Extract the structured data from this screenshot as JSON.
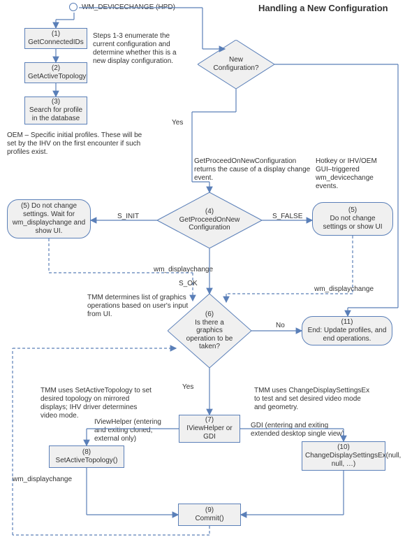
{
  "title": "Handling a New Configuration",
  "start_label": "WM_DEVICECHANGE (HPD)",
  "notes": {
    "steps_enum": "Steps 1-3 enumerate the current configuration and determine whether this is a new display configuration.",
    "oem_profiles": "OEM – Specific initial profiles. These will be set by the IHV on the first encounter if such profiles exist.",
    "getproceed_cause": "GetProceedOnNewConfiguration returns the cause of a display change event.",
    "hotkey": "Hotkey or IHV/OEM GUI–triggered wm_devicechange events.",
    "tmm_list": "TMM determines list of graphics operations based on user's input from UI.",
    "tmm_setactive": "TMM uses SetActiveTopology to set desired topology on mirrored displays; IHV driver determines video mode.",
    "iview_note": "IViewHelper (entering and exiting cloned, external only)",
    "gdi_note": "GDI (entering and exiting extended desktop single view)",
    "tmm_cds": "TMM uses ChangeDisplaySettingsEx to test and set desired video mode and geometry."
  },
  "nodes": {
    "n1": {
      "num": "(1)",
      "label": "GetConnectedIDs"
    },
    "n2": {
      "num": "(2)",
      "label": "GetActiveTopology"
    },
    "n3": {
      "num": "(3)",
      "label": "Search for profile in the database"
    },
    "d_newcfg": {
      "label": "New Configuration?"
    },
    "n4": {
      "num": "(4)",
      "label": "GetProceedOnNew Configuration"
    },
    "n5a": {
      "num": "(5) Do not change settings. Wait for wm_displaychange and show UI."
    },
    "n5b": {
      "num": "(5)",
      "label": "Do not change settings or show UI"
    },
    "d6": {
      "num": "(6)",
      "label": "Is there a graphics operation to be taken?"
    },
    "n7": {
      "num": "(7)",
      "label": "IViewHelper or GDI"
    },
    "n8": {
      "num": "(8)",
      "label": "SetActiveTopology()"
    },
    "n9": {
      "num": "(9)",
      "label": "Commit()"
    },
    "n10": {
      "num": "(10)",
      "label": "ChangeDisplaySettingsEx(null, null, …)"
    },
    "n11": {
      "num": "(11)",
      "label": "End:  Update profiles, and end operations."
    }
  },
  "edges": {
    "yes": "Yes",
    "no": "No",
    "s_init": "S_INIT",
    "s_false": "S_FALSE",
    "s_ok": "S_OK",
    "wm_dc_left": "wm_displaychange",
    "wm_dc_mid": "wm_displaychange",
    "wm_dc_right": "wm_displaychange"
  },
  "chart_data": {
    "type": "flowchart",
    "title": "Handling a New Configuration",
    "start": "WM_DEVICECHANGE (HPD)",
    "nodes": [
      {
        "id": "start",
        "type": "start",
        "label": "WM_DEVICECHANGE (HPD)"
      },
      {
        "id": "1",
        "type": "process",
        "label": "GetConnectedIDs"
      },
      {
        "id": "2",
        "type": "process",
        "label": "GetActiveTopology"
      },
      {
        "id": "3",
        "type": "process",
        "label": "Search for profile in the database"
      },
      {
        "id": "newcfg",
        "type": "decision",
        "label": "New Configuration?"
      },
      {
        "id": "4",
        "type": "decision",
        "label": "GetProceedOnNewConfiguration"
      },
      {
        "id": "5a",
        "type": "terminator",
        "label": "Do not change settings. Wait for wm_displaychange and show UI."
      },
      {
        "id": "5b",
        "type": "terminator",
        "label": "Do not change settings or show UI"
      },
      {
        "id": "6",
        "type": "decision",
        "label": "Is there a graphics operation to be taken?"
      },
      {
        "id": "7",
        "type": "process",
        "label": "IViewHelper or GDI"
      },
      {
        "id": "8",
        "type": "process",
        "label": "SetActiveTopology()"
      },
      {
        "id": "9",
        "type": "process",
        "label": "Commit()"
      },
      {
        "id": "10",
        "type": "process",
        "label": "ChangeDisplaySettingsEx(null, null, …)"
      },
      {
        "id": "11",
        "type": "terminator",
        "label": "End: Update profiles, and end operations."
      }
    ],
    "edges": [
      {
        "from": "start",
        "to": "1"
      },
      {
        "from": "1",
        "to": "2"
      },
      {
        "from": "2",
        "to": "3"
      },
      {
        "from": "start",
        "to": "newcfg"
      },
      {
        "from": "newcfg",
        "to": "4",
        "label": "Yes"
      },
      {
        "from": "newcfg",
        "to": "11",
        "label": "No"
      },
      {
        "from": "4",
        "to": "5a",
        "label": "S_INIT"
      },
      {
        "from": "4",
        "to": "5b",
        "label": "S_FALSE"
      },
      {
        "from": "4",
        "to": "6",
        "label": "S_OK"
      },
      {
        "from": "5a",
        "to": "6",
        "label": "wm_displaychange",
        "style": "dashed"
      },
      {
        "from": "5b",
        "to": "6",
        "label": "wm_displaychange",
        "style": "dashed"
      },
      {
        "from": "6",
        "to": "11",
        "label": "No"
      },
      {
        "from": "6",
        "to": "7",
        "label": "Yes"
      },
      {
        "from": "7",
        "to": "8",
        "label": "IViewHelper"
      },
      {
        "from": "7",
        "to": "10",
        "label": "GDI"
      },
      {
        "from": "8",
        "to": "9"
      },
      {
        "from": "10",
        "to": "9"
      },
      {
        "from": "9",
        "to": "6",
        "label": "wm_displaychange",
        "style": "dashed"
      }
    ]
  }
}
